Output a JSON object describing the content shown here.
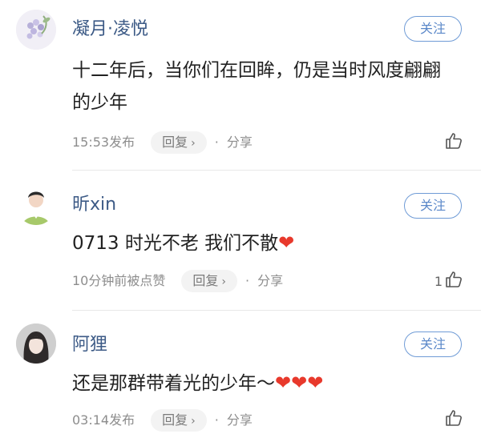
{
  "comments": [
    {
      "username": "凝月·凌悦",
      "follow_label": "关注",
      "text": "十二年后，当你们在回眸，仍是当时风度翩翩的少年",
      "hearts": "",
      "time": "15:53发布",
      "reply_label": "回复",
      "share_label": "分享",
      "like_count": "",
      "avatar": "flower-avatar"
    },
    {
      "username": "昕xin",
      "follow_label": "关注",
      "text": "0713 时光不老 我们不散",
      "hearts": "❤",
      "time": "10分钟前被点赞",
      "reply_label": "回复",
      "share_label": "分享",
      "like_count": "1",
      "avatar": "boy-avatar"
    },
    {
      "username": "阿狸",
      "follow_label": "关注",
      "text": "还是那群带着光的少年～",
      "hearts": "❤❤❤",
      "time": "03:14发布",
      "reply_label": "回复",
      "share_label": "分享",
      "like_count": "",
      "avatar": "girl-avatar"
    }
  ],
  "colors": {
    "username": "#3c5a86",
    "follow_border": "#6f9bd6",
    "heart": "#e8392c",
    "meta": "#8d8d8d"
  }
}
